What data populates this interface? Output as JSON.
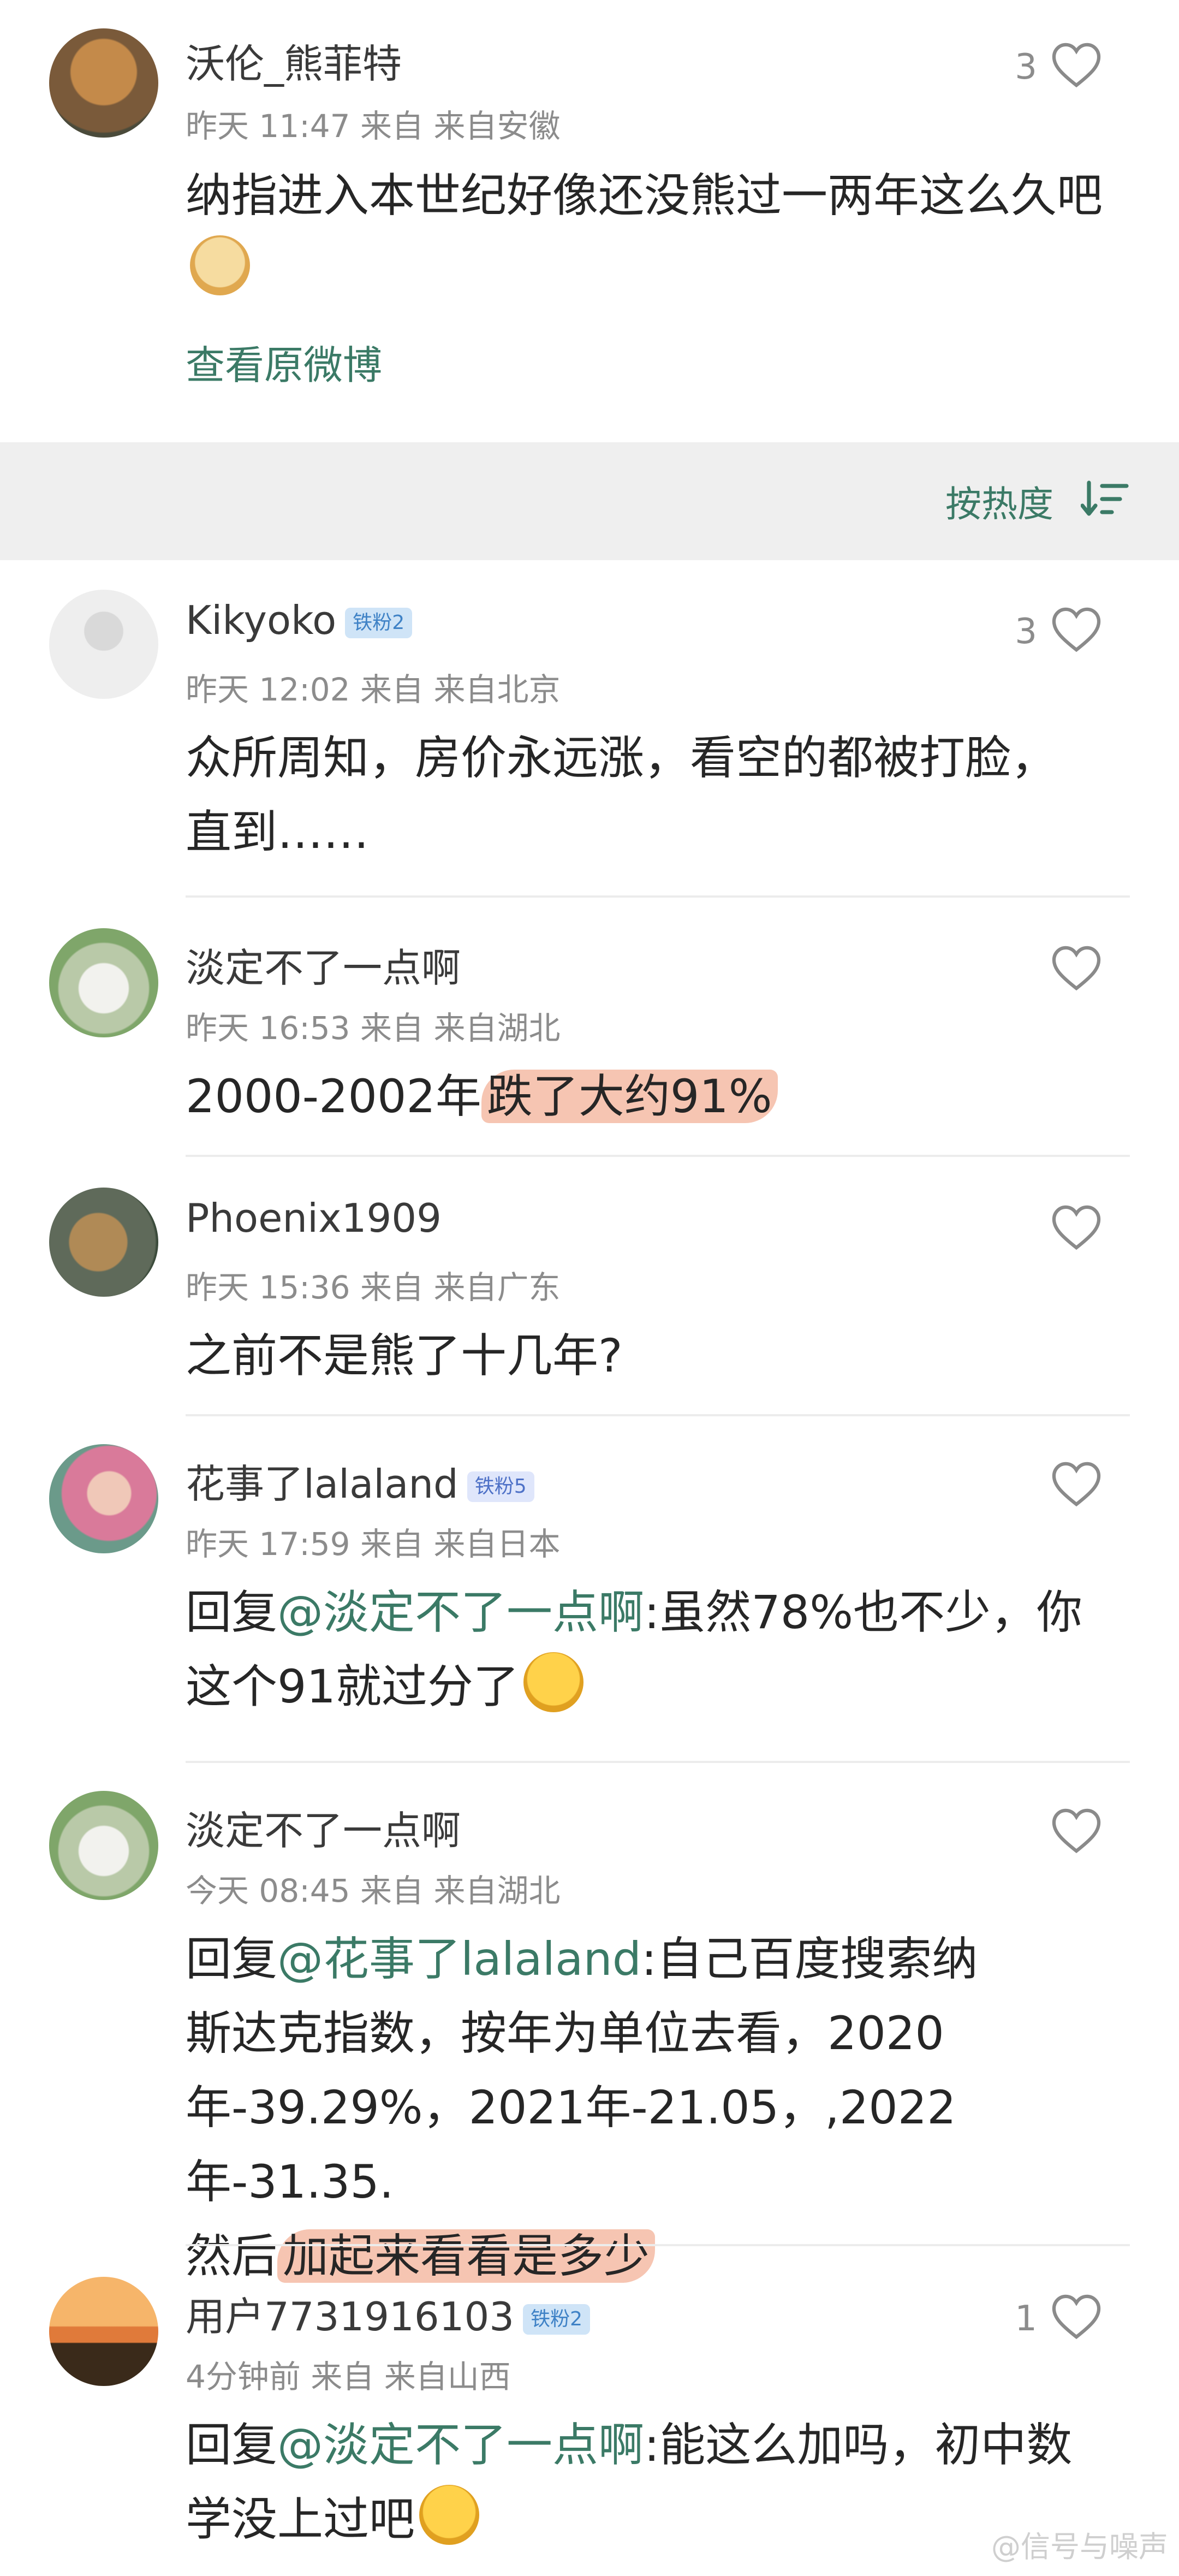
{
  "main_comment": {
    "username": "沃伦_熊菲特",
    "time": "昨天 11:47",
    "source": "来自",
    "location": "来自安徽",
    "text": "纳指进入本世纪好像还没熊过一两年这么久吧",
    "likes": "3",
    "view_original": "查看原微博"
  },
  "sort": {
    "label": "按热度"
  },
  "replies": [
    {
      "username": "Kikyoko",
      "badge": "铁粉2",
      "time": "昨天 12:02",
      "source": "来自",
      "location": "来自北京",
      "text_line1": "众所周知，房价永远涨，看空的都被打脸，",
      "text_line2": "直到……",
      "likes": "3"
    },
    {
      "username": "淡定不了一点啊",
      "time": "昨天 16:53",
      "source": "来自",
      "location": "来自湖北",
      "text_plain": "2000-2002年",
      "text_highlight": "跌了大约91%",
      "likes": ""
    },
    {
      "username": "Phoenix1909",
      "time": "昨天 15:36",
      "source": "来自",
      "location": "来自广东",
      "text": "之前不是熊了十几年?",
      "likes": ""
    },
    {
      "username": "花事了lalaland",
      "badge": "铁粉5",
      "time": "昨天 17:59",
      "source": "来自",
      "location": "来自日本",
      "reply_prefix": "回复",
      "mention": "@淡定不了一点啊",
      "text_line1": ":虽然78%也不少，你",
      "text_line2": "这个91就过分了",
      "likes": ""
    },
    {
      "username": "淡定不了一点啊",
      "time": "今天 08:45",
      "source": "来自",
      "location": "来自湖北",
      "reply_prefix": "回复",
      "mention": "@花事了lalaland",
      "text_line1": ":自己百度搜索纳",
      "text_line2": "斯达克指数，按年为单位去看，2020",
      "text_line3": "年-39.29%，2021年-21.05，,2022年-31.35.",
      "text_line4_plain": "然后",
      "text_line4_highlight": "加起来看看是多少",
      "likes": ""
    },
    {
      "username": "用户7731916103",
      "badge": "铁粉2",
      "time": "4分钟前",
      "source": "来自",
      "location": "来自山西",
      "reply_prefix": "回复",
      "mention": "@淡定不了一点啊",
      "text_line1": ":能这么加吗，初中数",
      "text_line2": "学没上过吧",
      "likes": "1"
    }
  ],
  "watermark": "@信号与噪声",
  "colors": {
    "accent": "#3b7a66",
    "highlight": "#f6c5b2",
    "band": "#efefef"
  }
}
